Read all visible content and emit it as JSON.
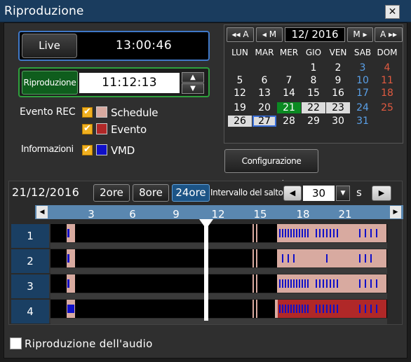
{
  "window": {
    "title": "Riproduzione",
    "close_label": "✕"
  },
  "live": {
    "button_label": "Live",
    "time": "13:00:46"
  },
  "playback": {
    "button_label": "Riproduzione",
    "time": "11:12:13",
    "up_icon": "▲",
    "down_icon": "▼"
  },
  "filters": {
    "event_rec_label": "Evento REC",
    "schedule_label": "Schedule",
    "event_label": "Evento",
    "info_label": "Informazioni",
    "vmd_label": "VMD",
    "checkmark": "✔",
    "colors": {
      "schedule": "#d8aaa0",
      "event": "#b02828",
      "vmd": "#1010c8"
    }
  },
  "calendar": {
    "prev_year": "◂◂ A",
    "prev_month": "◂ M",
    "month_label": "12/ 2016",
    "next_month": "M ▸",
    "next_year": "A ▸▸",
    "weekdays": [
      "LUN",
      "MAR",
      "MER",
      "GIO",
      "VEN",
      "SAB",
      "DOM"
    ],
    "weeks": [
      [
        "",
        "",
        "",
        "1",
        "2",
        "3",
        "4"
      ],
      [
        "5",
        "6",
        "7",
        "8",
        "9",
        "10",
        "11"
      ],
      [
        "12",
        "13",
        "14",
        "15",
        "16",
        "17",
        "18"
      ],
      [
        "19",
        "20",
        "21",
        "22",
        "23",
        "24",
        "25"
      ],
      [
        "26",
        "27",
        "28",
        "29",
        "30",
        "31",
        ""
      ]
    ],
    "recorded_days": [
      "21",
      "22",
      "23",
      "26",
      "27"
    ],
    "today": "21",
    "selected": "27",
    "colors": {
      "saturday": "#5aa0e8",
      "sunday": "#e05a40",
      "today_bg": "#0b8a22",
      "recorded_bg": "#dcdcdc",
      "selected_border": "#3a6fd8"
    }
  },
  "advanced_button": "Configurazione avanzata",
  "timeline": {
    "date": "21/12/2016",
    "zoom_options": [
      "2ore",
      "8ore",
      "24ore"
    ],
    "zoom_selected": "24ore",
    "skip_label": "Intervallo del salto",
    "skip_value": "30",
    "skip_unit": "s",
    "skip_prev": "◀",
    "skip_next": "▶",
    "scale_ticks": [
      "3",
      "6",
      "9",
      "12",
      "15",
      "18",
      "21"
    ],
    "scroll_left": "◀",
    "scroll_right": "▶",
    "cameras": [
      "1",
      "2",
      "3",
      "4"
    ]
  },
  "audio": {
    "label": "Riproduzione dell'audio",
    "checked": false
  }
}
